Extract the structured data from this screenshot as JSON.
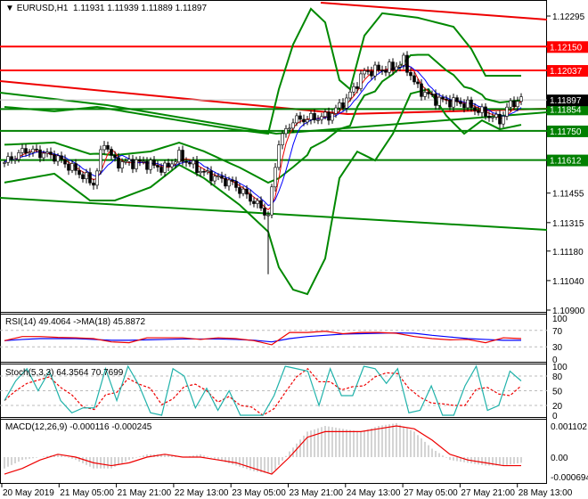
{
  "header": {
    "symbol": "EURUSD,H1",
    "ohlc": "1.11931 1.11939 1.11889 1.11897"
  },
  "chart_data": {
    "type": "candlestick",
    "symbol": "EURUSD",
    "timeframe": "H1",
    "ylim": [
      1.109,
      1.12295
    ],
    "price_ticks": [
      "1.12295",
      "1.11455",
      "1.11315",
      "1.11180",
      "1.11040",
      "1.10900"
    ],
    "levels": [
      {
        "price": 1.1215,
        "label": "1.12150",
        "color": "#ff0000"
      },
      {
        "price": 1.12037,
        "label": "1.12037",
        "color": "#ff0000"
      },
      {
        "price": 1.11854,
        "label": "1.11854",
        "color": "#008000"
      },
      {
        "price": 1.1175,
        "label": "1.11750",
        "color": "#008000"
      },
      {
        "price": 1.11612,
        "label": "1.11612",
        "color": "#008000"
      }
    ],
    "current_price": {
      "price": 1.11897,
      "label": "1.11897"
    },
    "bars": 146,
    "close_keypoints": [
      [
        0,
        1.116
      ],
      [
        6,
        1.1166
      ],
      [
        14,
        1.1163
      ],
      [
        21,
        1.1155
      ],
      [
        25,
        1.115
      ],
      [
        28,
        1.117
      ],
      [
        31,
        1.116
      ],
      [
        39,
        1.116
      ],
      [
        45,
        1.1157
      ],
      [
        49,
        1.1163
      ],
      [
        56,
        1.1155
      ],
      [
        64,
        1.115
      ],
      [
        71,
        1.114
      ],
      [
        74,
        1.1135
      ],
      [
        77,
        1.117
      ],
      [
        81,
        1.118
      ],
      [
        91,
        1.1182
      ],
      [
        96,
        1.119
      ],
      [
        101,
        1.1203
      ],
      [
        109,
        1.1205
      ],
      [
        112,
        1.1208
      ],
      [
        116,
        1.1195
      ],
      [
        121,
        1.119
      ],
      [
        129,
        1.1188
      ],
      [
        135,
        1.1183
      ],
      [
        139,
        1.118
      ],
      [
        142,
        1.1188
      ],
      [
        145,
        1.11897
      ]
    ],
    "bb_upper": [
      [
        0,
        1.11864
      ],
      [
        14,
        1.11843
      ],
      [
        26,
        1.11864
      ],
      [
        49,
        1.118
      ],
      [
        64,
        1.11758
      ],
      [
        74,
        1.11737
      ],
      [
        77,
        1.11948
      ],
      [
        81,
        1.1216
      ],
      [
        86,
        1.12329
      ],
      [
        90,
        1.12265
      ],
      [
        94,
        1.11991
      ],
      [
        97,
        1.11948
      ],
      [
        101,
        1.12202
      ],
      [
        106,
        1.12308
      ],
      [
        116,
        1.12287
      ],
      [
        126,
        1.12244
      ],
      [
        131,
        1.12139
      ],
      [
        135,
        1.12012
      ],
      [
        145,
        1.12012
      ]
    ],
    "bb_lower": [
      [
        0,
        1.11505
      ],
      [
        14,
        1.11547
      ],
      [
        24,
        1.1142
      ],
      [
        31,
        1.1142
      ],
      [
        41,
        1.11483
      ],
      [
        49,
        1.11589
      ],
      [
        56,
        1.11526
      ],
      [
        66,
        1.11399
      ],
      [
        74,
        1.11272
      ],
      [
        77,
        1.11103
      ],
      [
        81,
        1.10997
      ],
      [
        85,
        1.10976
      ],
      [
        90,
        1.11145
      ],
      [
        94,
        1.11526
      ],
      [
        99,
        1.11652
      ],
      [
        104,
        1.1161
      ],
      [
        109,
        1.11737
      ],
      [
        114,
        1.11927
      ],
      [
        119,
        1.11948
      ],
      [
        124,
        1.11822
      ],
      [
        129,
        1.11737
      ],
      [
        134,
        1.118
      ],
      [
        139,
        1.11758
      ],
      [
        145,
        1.11779
      ]
    ],
    "time_labels": [
      "20 May 2019",
      "21 May 05:00",
      "21 May 21:00",
      "22 May 13:00",
      "23 May 05:00",
      "23 May 21:00",
      "24 May 13:00",
      "27 May 05:00",
      "27 May 21:00",
      "28 May 13:00"
    ],
    "rsi": {
      "label": "RSI(14) 49.4064  ->MA(18) 45.8872",
      "levels": [
        "100",
        "70",
        "30",
        "0"
      ],
      "rsi": [
        45,
        55,
        55,
        53,
        52,
        50,
        42,
        40,
        52,
        52,
        52,
        48,
        52,
        50,
        45,
        35,
        65,
        65,
        68,
        62,
        65,
        65,
        63,
        55,
        50,
        47,
        48,
        40,
        52,
        50
      ],
      "ma": [
        45,
        48,
        50,
        50,
        50,
        48,
        46,
        46,
        47,
        48,
        49,
        49,
        49,
        48,
        46,
        42,
        50,
        55,
        58,
        61,
        62,
        63,
        64,
        63,
        58,
        54,
        50,
        48,
        46,
        46
      ]
    },
    "stoch": {
      "label": "Stoch(5,3,3) 64.3564 70.7699",
      "levels": [
        "100",
        "80",
        "50",
        "20",
        "0"
      ],
      "main": [
        30,
        70,
        95,
        50,
        90,
        30,
        5,
        15,
        15,
        95,
        30,
        100,
        60,
        5,
        0,
        95,
        80,
        15,
        55,
        10,
        50,
        0,
        0,
        0,
        40,
        100,
        95,
        90,
        20,
        95,
        40,
        40,
        100,
        95,
        65,
        95,
        5,
        10,
        60,
        0,
        0,
        60,
        100,
        10,
        20,
        90,
        70
      ]
    },
    "macd": {
      "label": "MACD(12,26,9) -0.000116 -0.000245",
      "levels": [
        "0.001102",
        "0.00",
        "-0.000694"
      ],
      "signal": [
        -0.0006,
        -0.0004,
        -0.0001,
        0.0001,
        0.0,
        -0.0002,
        -0.0003,
        -0.0002,
        0.0,
        0.0001,
        0.0,
        0.0,
        -0.0001,
        -0.0002,
        -0.0004,
        -0.0006,
        0.0,
        0.0007,
        0.0009,
        0.0009,
        0.0009,
        0.001,
        0.0011,
        0.001,
        0.0006,
        0.0001,
        -0.0001,
        -0.0002,
        -0.0003,
        -0.0003
      ],
      "hist": [
        -0.0004,
        -0.0001,
        0.0,
        0.0001,
        -0.0001,
        -0.0004,
        -0.0004,
        -0.0001,
        0.0001,
        0.0001,
        0.0,
        0.0001,
        -0.0001,
        -0.0003,
        -0.0005,
        -0.0006,
        0.0002,
        0.0009,
        0.0011,
        0.001,
        0.0009,
        0.0011,
        0.0012,
        0.0009,
        0.0003,
        -0.0001,
        -0.0002,
        -0.0003,
        -0.0003,
        -0.0002
      ]
    }
  }
}
